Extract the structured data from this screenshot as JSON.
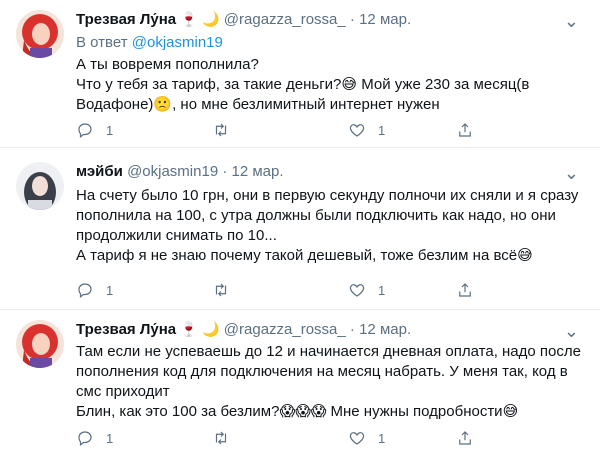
{
  "tweets": [
    {
      "name": "Трезвая Лу́на",
      "name_emoji": "🍷 🌙",
      "handle": "@ragazza_rossa_",
      "dot": "·",
      "date": "12 мар.",
      "reply_prefix": "В ответ",
      "reply_handle": "@okjasmin19",
      "text": "А ты вовремя пополнила?\nЧто у тебя за тариф, за такие деньги?😅 Мой уже 230 за месяц(в Водафоне)🙁, но мне безлимитный интернет нужен",
      "reply_count": "1",
      "retweet_count": "",
      "like_count": "1"
    },
    {
      "name": "мэйби",
      "handle": "@okjasmin19",
      "dot": "·",
      "date": "12 мар.",
      "text": "На счету было 10 грн, они в первую секунду полночи их сняли и я сразу пополнила на 100, с утра должны были подключить как надо, но они продолжили снимать по 10...\nА тариф я не знаю почему такой дешевый, тоже безлим на всё😅",
      "reply_count": "1",
      "retweet_count": "",
      "like_count": "1"
    },
    {
      "name": "Трезвая Лу́на",
      "name_emoji": "🍷 🌙",
      "handle": "@ragazza_rossa_",
      "dot": "·",
      "date": "12 мар.",
      "text": "Там если не успеваешь до 12 и начинается дневная оплата, надо после пополнения код для подключения на месяц набрать. У меня так, код в смс приходит\nБлин, как это 100 за безлим?😱😱😱 Мне нужны подробности😅",
      "reply_count": "1",
      "retweet_count": "",
      "like_count": "1"
    }
  ],
  "icons": {
    "reply": "reply-icon",
    "retweet": "retweet-icon",
    "like": "heart-icon",
    "share": "share-icon",
    "more": "more-icon"
  },
  "colors": {
    "link": "#1b95e0",
    "secondary": "#5b7083",
    "divider": "#e6ecf0"
  }
}
